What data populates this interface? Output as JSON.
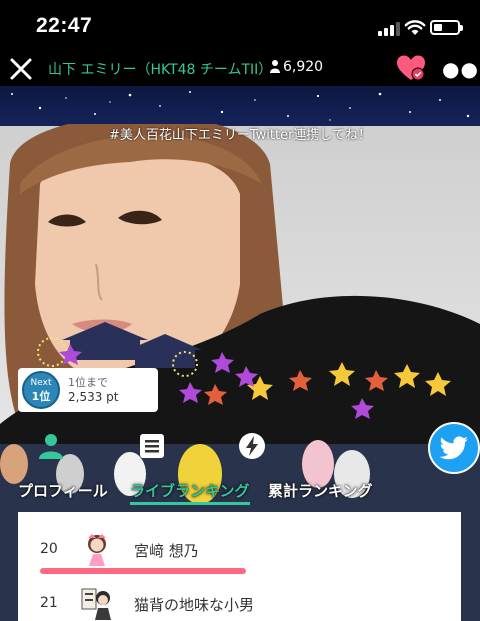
{
  "status_bar": {
    "time": "22:47"
  },
  "header": {
    "title": "山下 エミリー（HKT48 チームTII）",
    "viewer_count": "6,920",
    "accent_color": "#35c89d",
    "heart_color": "#ff5a7e"
  },
  "stream": {
    "hashtag_banner": "#美人百花山下エミリーTwitter連携してね！",
    "next_badge": {
      "word": "Next",
      "rank": "1位",
      "gap_label": "1位まで",
      "gap_points": "2,533 pt"
    }
  },
  "tabs": {
    "icons": [
      "profile-icon",
      "ranking-list-icon",
      "lightning-icon"
    ],
    "items": [
      {
        "label": "プロフィール",
        "active": false
      },
      {
        "label": "ライブランキング",
        "active": true
      },
      {
        "label": "累計ランキング",
        "active": false
      }
    ]
  },
  "ranking": {
    "rows": [
      {
        "rank": "20",
        "name": "宮﨑 想乃",
        "avatar": "girl-avatar"
      },
      {
        "rank": "21",
        "name": "猫背の地味な小男",
        "avatar": "boy-avatar"
      }
    ]
  }
}
